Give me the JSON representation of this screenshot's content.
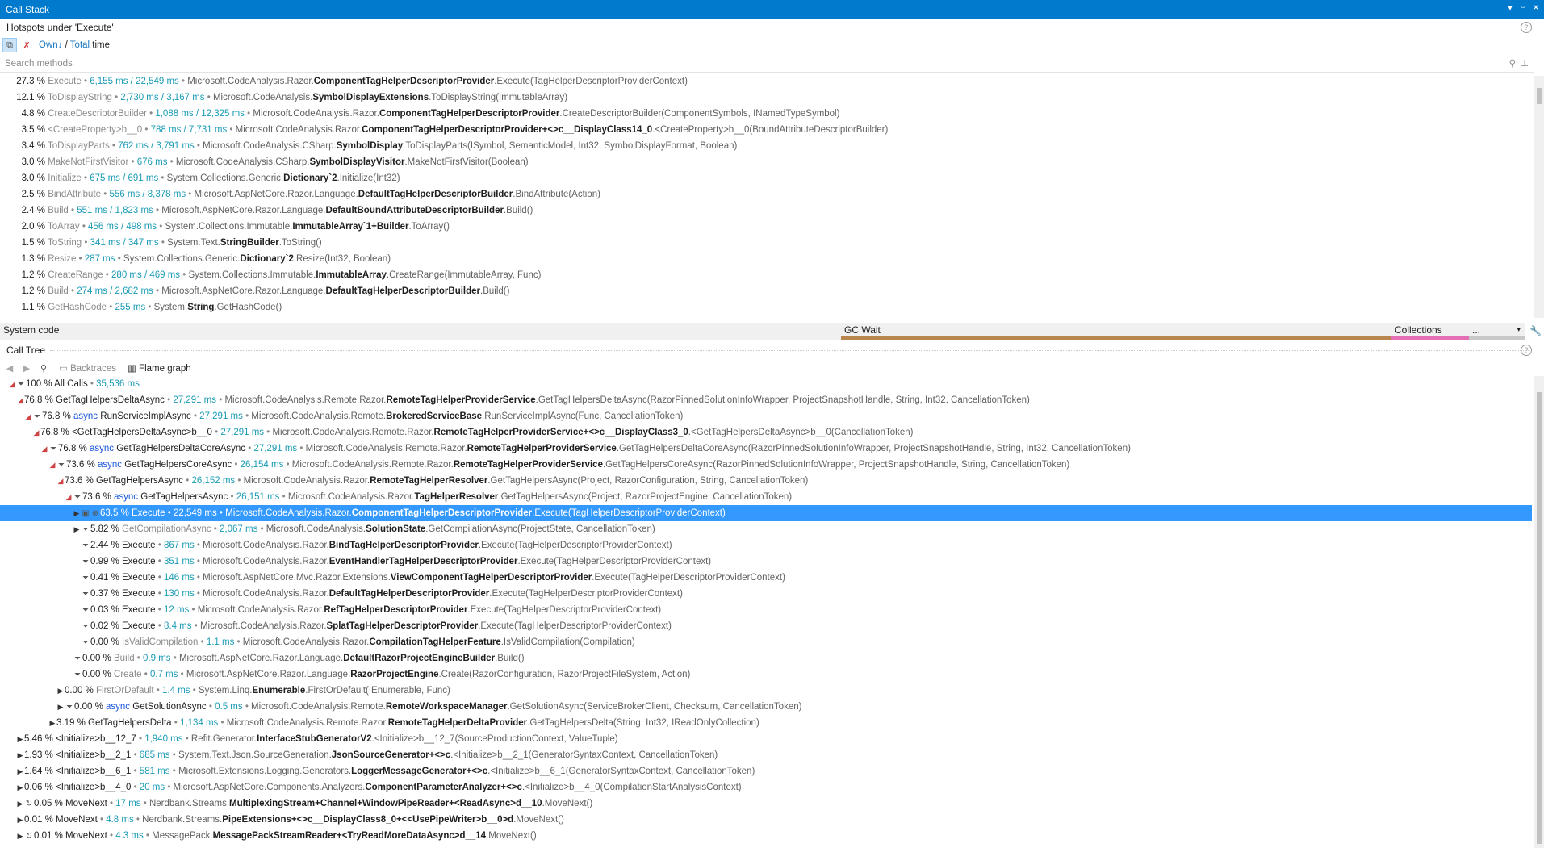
{
  "window": {
    "title": "Call Stack"
  },
  "hotspots": {
    "title": "Hotspots under 'Execute'",
    "own_label": "Own",
    "own_suffix": "↓",
    "separator": " / ",
    "total_label": "Total",
    "time_label": " time",
    "search_placeholder": "Search methods",
    "rows": [
      {
        "pct": "27.3 %",
        "name": "Execute",
        "times": "6,155 ms / 22,549 ms",
        "ns": "Microsoft.CodeAnalysis.Razor.",
        "cls": "ComponentTagHelperDescriptorProvider",
        "sig": ".Execute(TagHelperDescriptorProviderContext)"
      },
      {
        "pct": "12.1 %",
        "name": "ToDisplayString",
        "times": "2,730 ms / 3,167 ms",
        "ns": "Microsoft.CodeAnalysis.",
        "cls": "SymbolDisplayExtensions",
        "sig": ".ToDisplayString(ImmutableArray)"
      },
      {
        "pct": "4.8 %",
        "name": "CreateDescriptorBuilder",
        "times": "1,088 ms / 12,325 ms",
        "ns": "Microsoft.CodeAnalysis.Razor.",
        "cls": "ComponentTagHelperDescriptorProvider",
        "sig": ".CreateDescriptorBuilder(ComponentSymbols, INamedTypeSymbol)"
      },
      {
        "pct": "3.5 %",
        "name": "<CreateProperty>b__0",
        "times": "788 ms / 7,731 ms",
        "ns": "Microsoft.CodeAnalysis.Razor.",
        "cls": "ComponentTagHelperDescriptorProvider+<>c__DisplayClass14_0",
        "sig": ".<CreateProperty>b__0(BoundAttributeDescriptorBuilder)"
      },
      {
        "pct": "3.4 %",
        "name": "ToDisplayParts",
        "times": "762 ms / 3,791 ms",
        "ns": "Microsoft.CodeAnalysis.CSharp.",
        "cls": "SymbolDisplay",
        "sig": ".ToDisplayParts(ISymbol, SemanticModel, Int32, SymbolDisplayFormat, Boolean)"
      },
      {
        "pct": "3.0 %",
        "name": "MakeNotFirstVisitor",
        "times": "676 ms",
        "ns": "Microsoft.CodeAnalysis.CSharp.",
        "cls": "SymbolDisplayVisitor",
        "sig": ".MakeNotFirstVisitor(Boolean)"
      },
      {
        "pct": "3.0 %",
        "name": "Initialize",
        "times": "675 ms / 691 ms",
        "ns": "System.Collections.Generic.",
        "cls": "Dictionary`2",
        "sig": ".Initialize(Int32)"
      },
      {
        "pct": "2.5 %",
        "name": "BindAttribute",
        "times": "556 ms / 8,378 ms",
        "ns": "Microsoft.AspNetCore.Razor.Language.",
        "cls": "DefaultTagHelperDescriptorBuilder",
        "sig": ".BindAttribute(Action)"
      },
      {
        "pct": "2.4 %",
        "name": "Build",
        "times": "551 ms / 1,823 ms",
        "ns": "Microsoft.AspNetCore.Razor.Language.",
        "cls": "DefaultBoundAttributeDescriptorBuilder",
        "sig": ".Build()"
      },
      {
        "pct": "2.0 %",
        "name": "ToArray",
        "times": "456 ms / 498 ms",
        "ns": "System.Collections.Immutable.",
        "cls": "ImmutableArray`1+Builder",
        "sig": ".ToArray()"
      },
      {
        "pct": "1.5 %",
        "name": "ToString",
        "times": "341 ms / 347 ms",
        "ns": "System.Text.",
        "cls": "StringBuilder",
        "sig": ".ToString()"
      },
      {
        "pct": "1.3 %",
        "name": "Resize",
        "times": "287 ms",
        "ns": "System.Collections.Generic.",
        "cls": "Dictionary`2",
        "sig": ".Resize(Int32, Boolean)"
      },
      {
        "pct": "1.2 %",
        "name": "CreateRange",
        "times": "280 ms / 469 ms",
        "ns": "System.Collections.Immutable.",
        "cls": "ImmutableArray",
        "sig": ".CreateRange(ImmutableArray, Func)"
      },
      {
        "pct": "1.2 %",
        "name": "Build",
        "times": "274 ms / 2,682 ms",
        "ns": "Microsoft.AspNetCore.Razor.Language.",
        "cls": "DefaultTagHelperDescriptorBuilder",
        "sig": ".Build()"
      },
      {
        "pct": "1.1 %",
        "name": "GetHashCode",
        "times": "255 ms",
        "ns": "System.",
        "cls": "String",
        "sig": ".GetHashCode()"
      }
    ]
  },
  "breakdown": {
    "system_code": "System code",
    "gc_wait": "GC Wait",
    "collections": "Collections",
    "more": "...",
    "colors": {
      "gc": "#b8854e",
      "collections": "#e56fb5",
      "other": "#c8c8c8"
    }
  },
  "calltree": {
    "title": "Call Tree",
    "backtraces": "Backtraces",
    "flame_graph": "Flame graph",
    "rows": [
      {
        "ind": 0,
        "exp": "open",
        "filt": true,
        "pct": "100 %",
        "async": false,
        "name": "All Calls",
        "ms": "35,536 ms",
        "ns": "",
        "cls": "",
        "sig": ""
      },
      {
        "ind": 1,
        "exp": "open",
        "filt": false,
        "pct": "76.8 %",
        "async": false,
        "name": "GetTagHelpersDeltaAsync",
        "ms": "27,291 ms",
        "ns": "Microsoft.CodeAnalysis.Remote.Razor.",
        "cls": "RemoteTagHelperProviderService",
        "sig": ".GetTagHelpersDeltaAsync(RazorPinnedSolutionInfoWrapper, ProjectSnapshotHandle, String, Int32, CancellationToken)"
      },
      {
        "ind": 2,
        "exp": "open",
        "filt": true,
        "pct": "76.8 %",
        "async": true,
        "name": "RunServiceImplAsync",
        "ms": "27,291 ms",
        "ns": "Microsoft.CodeAnalysis.Remote.",
        "cls": "BrokeredServiceBase",
        "sig": ".RunServiceImplAsync(Func, CancellationToken)"
      },
      {
        "ind": 3,
        "exp": "open",
        "filt": false,
        "pct": "76.8 %",
        "async": false,
        "name": "<GetTagHelpersDeltaAsync>b__0",
        "ms": "27,291 ms",
        "ns": "Microsoft.CodeAnalysis.Remote.Razor.",
        "cls": "RemoteTagHelperProviderService+<>c__DisplayClass3_0",
        "sig": ".<GetTagHelpersDeltaAsync>b__0(CancellationToken)"
      },
      {
        "ind": 4,
        "exp": "open",
        "filt": true,
        "pct": "76.8 %",
        "async": true,
        "name": "GetTagHelpersDeltaCoreAsync",
        "ms": "27,291 ms",
        "ns": "Microsoft.CodeAnalysis.Remote.Razor.",
        "cls": "RemoteTagHelperProviderService",
        "sig": ".GetTagHelpersDeltaCoreAsync(RazorPinnedSolutionInfoWrapper, ProjectSnapshotHandle, String, Int32, CancellationToken)"
      },
      {
        "ind": 5,
        "exp": "open",
        "filt": true,
        "pct": "73.6 %",
        "async": true,
        "name": "GetTagHelpersCoreAsync",
        "ms": "26,154 ms",
        "ns": "Microsoft.CodeAnalysis.Remote.Razor.",
        "cls": "RemoteTagHelperProviderService",
        "sig": ".GetTagHelpersCoreAsync(RazorPinnedSolutionInfoWrapper, ProjectSnapshotHandle, String, CancellationToken)"
      },
      {
        "ind": 6,
        "exp": "open",
        "filt": false,
        "pct": "73.6 %",
        "async": false,
        "name": "GetTagHelpersAsync",
        "ms": "26,152 ms",
        "ns": "Microsoft.CodeAnalysis.Razor.",
        "cls": "RemoteTagHelperResolver",
        "sig": ".GetTagHelpersAsync(Project, RazorConfiguration, String, CancellationToken)"
      },
      {
        "ind": 7,
        "exp": "open",
        "filt": true,
        "pct": "73.6 %",
        "async": true,
        "name": "GetTagHelpersAsync",
        "ms": "26,151 ms",
        "ns": "Microsoft.CodeAnalysis.Razor.",
        "cls": "TagHelperResolver",
        "sig": ".GetTagHelpersAsync(Project, RazorProjectEngine, CancellationToken)"
      },
      {
        "ind": 8,
        "exp": "closed",
        "filt": false,
        "sel": true,
        "pct": "63.5 %",
        "async": false,
        "name": "Execute",
        "ms": "22,549 ms",
        "ns": "Microsoft.CodeAnalysis.Razor.",
        "cls": "ComponentTagHelperDescriptorProvider",
        "sig": ".Execute(TagHelperDescriptorProviderContext)"
      },
      {
        "ind": 8,
        "exp": "closed",
        "filt": true,
        "pct": "5.82 %",
        "async": false,
        "dim": true,
        "name": "GetCompilationAsync",
        "ms": "2,067 ms",
        "ns": "Microsoft.CodeAnalysis.",
        "cls": "SolutionState",
        "sig": ".GetCompilationAsync(ProjectState, CancellationToken)"
      },
      {
        "ind": 8,
        "exp": "none",
        "filt": true,
        "pct": "2.44 %",
        "async": false,
        "name": "Execute",
        "ms": "867 ms",
        "ns": "Microsoft.CodeAnalysis.Razor.",
        "cls": "BindTagHelperDescriptorProvider",
        "sig": ".Execute(TagHelperDescriptorProviderContext)"
      },
      {
        "ind": 8,
        "exp": "none",
        "filt": true,
        "pct": "0.99 %",
        "async": false,
        "name": "Execute",
        "ms": "351 ms",
        "ns": "Microsoft.CodeAnalysis.Razor.",
        "cls": "EventHandlerTagHelperDescriptorProvider",
        "sig": ".Execute(TagHelperDescriptorProviderContext)"
      },
      {
        "ind": 8,
        "exp": "none",
        "filt": true,
        "pct": "0.41 %",
        "async": false,
        "name": "Execute",
        "ms": "146 ms",
        "ns": "Microsoft.AspNetCore.Mvc.Razor.Extensions.",
        "cls": "ViewComponentTagHelperDescriptorProvider",
        "sig": ".Execute(TagHelperDescriptorProviderContext)"
      },
      {
        "ind": 8,
        "exp": "none",
        "filt": true,
        "pct": "0.37 %",
        "async": false,
        "name": "Execute",
        "ms": "130 ms",
        "ns": "Microsoft.CodeAnalysis.Razor.",
        "cls": "DefaultTagHelperDescriptorProvider",
        "sig": ".Execute(TagHelperDescriptorProviderContext)"
      },
      {
        "ind": 8,
        "exp": "none",
        "filt": true,
        "pct": "0.03 %",
        "async": false,
        "name": "Execute",
        "ms": "12 ms",
        "ns": "Microsoft.CodeAnalysis.Razor.",
        "cls": "RefTagHelperDescriptorProvider",
        "sig": ".Execute(TagHelperDescriptorProviderContext)"
      },
      {
        "ind": 8,
        "exp": "none",
        "filt": true,
        "pct": "0.02 %",
        "async": false,
        "name": "Execute",
        "ms": "8.4 ms",
        "ns": "Microsoft.CodeAnalysis.Razor.",
        "cls": "SplatTagHelperDescriptorProvider",
        "sig": ".Execute(TagHelperDescriptorProviderContext)"
      },
      {
        "ind": 8,
        "exp": "none",
        "filt": true,
        "pct": "0.00 %",
        "async": false,
        "dim": true,
        "name": "IsValidCompilation",
        "ms": "1.1 ms",
        "ns": "Microsoft.CodeAnalysis.Razor.",
        "cls": "CompilationTagHelperFeature",
        "sig": ".IsValidCompilation(Compilation)"
      },
      {
        "ind": 7,
        "exp": "none",
        "filt": true,
        "pct": "0.00 %",
        "async": false,
        "dim": true,
        "name": "Build",
        "ms": "0.9 ms",
        "ns": "Microsoft.AspNetCore.Razor.Language.",
        "cls": "DefaultRazorProjectEngineBuilder",
        "sig": ".Build()"
      },
      {
        "ind": 7,
        "exp": "none",
        "filt": true,
        "pct": "0.00 %",
        "async": false,
        "dim": true,
        "name": "Create",
        "ms": "0.7 ms",
        "ns": "Microsoft.AspNetCore.Razor.Language.",
        "cls": "RazorProjectEngine",
        "sig": ".Create(RazorConfiguration, RazorProjectFileSystem, Action)"
      },
      {
        "ind": 6,
        "exp": "closed",
        "filt": false,
        "pct": "0.00 %",
        "async": false,
        "dim": true,
        "name": "FirstOrDefault",
        "ms": "1.4 ms",
        "ns": "System.Linq.",
        "cls": "Enumerable",
        "sig": ".FirstOrDefault(IEnumerable, Func)"
      },
      {
        "ind": 6,
        "exp": "closed",
        "filt": true,
        "pct": "0.00 %",
        "async": true,
        "name": "GetSolutionAsync",
        "ms": "0.5 ms",
        "ns": "Microsoft.CodeAnalysis.Remote.",
        "cls": "RemoteWorkspaceManager",
        "sig": ".GetSolutionAsync(ServiceBrokerClient, Checksum, CancellationToken)"
      },
      {
        "ind": 5,
        "exp": "closed",
        "filt": false,
        "pct": "3.19 %",
        "async": false,
        "name": "GetTagHelpersDelta",
        "ms": "1,134 ms",
        "ns": "Microsoft.CodeAnalysis.Remote.Razor.",
        "cls": "RemoteTagHelperDeltaProvider",
        "sig": ".GetTagHelpersDelta(String, Int32, IReadOnlyCollection)"
      },
      {
        "ind": 1,
        "exp": "closed",
        "filt": false,
        "pct": "5.46 %",
        "async": false,
        "name": "<Initialize>b__12_7",
        "ms": "1,940 ms",
        "ns": "Refit.Generator.",
        "cls": "InterfaceStubGeneratorV2",
        "sig": ".<Initialize>b__12_7(SourceProductionContext, ValueTuple)"
      },
      {
        "ind": 1,
        "exp": "closed",
        "filt": false,
        "pct": "1.93 %",
        "async": false,
        "name": "<Initialize>b__2_1",
        "ms": "685 ms",
        "ns": "System.Text.Json.SourceGeneration.",
        "cls": "JsonSourceGenerator+<>c",
        "sig": ".<Initialize>b__2_1(GeneratorSyntaxContext, CancellationToken)"
      },
      {
        "ind": 1,
        "exp": "closed",
        "filt": false,
        "pct": "1.64 %",
        "async": false,
        "name": "<Initialize>b__6_1",
        "ms": "581 ms",
        "ns": "Microsoft.Extensions.Logging.Generators.",
        "cls": "LoggerMessageGenerator+<>c",
        "sig": ".<Initialize>b__6_1(GeneratorSyntaxContext, CancellationToken)"
      },
      {
        "ind": 1,
        "exp": "closed",
        "filt": false,
        "pct": "0.06 %",
        "async": false,
        "name": "<Initialize>b__4_0",
        "ms": "20 ms",
        "ns": "Microsoft.AspNetCore.Components.Analyzers.",
        "cls": "ComponentParameterAnalyzer+<>c",
        "sig": ".<Initialize>b__4_0(CompilationStartAnalysisContext)"
      },
      {
        "ind": 1,
        "exp": "closed",
        "filt": false,
        "loop": true,
        "pct": "0.05 %",
        "async": false,
        "name": "MoveNext",
        "ms": "17 ms",
        "ns": "Nerdbank.Streams.",
        "cls": "MultiplexingStream+Channel+WindowPipeReader+<ReadAsync>d__10",
        "sig": ".MoveNext()"
      },
      {
        "ind": 1,
        "exp": "closed",
        "filt": false,
        "pct": "0.01 %",
        "async": false,
        "name": "MoveNext",
        "ms": "4.8 ms",
        "ns": "Nerdbank.Streams.",
        "cls": "PipeExtensions+<>c__DisplayClass8_0+<<UsePipeWriter>b__0>d",
        "sig": ".MoveNext()"
      },
      {
        "ind": 1,
        "exp": "closed",
        "filt": false,
        "loop": true,
        "pct": "0.01 %",
        "async": false,
        "name": "MoveNext",
        "ms": "4.3 ms",
        "ns": "MessagePack.",
        "cls": "MessagePackStreamReader+<TryReadMoreDataAsync>d__14",
        "sig": ".MoveNext()"
      }
    ]
  }
}
